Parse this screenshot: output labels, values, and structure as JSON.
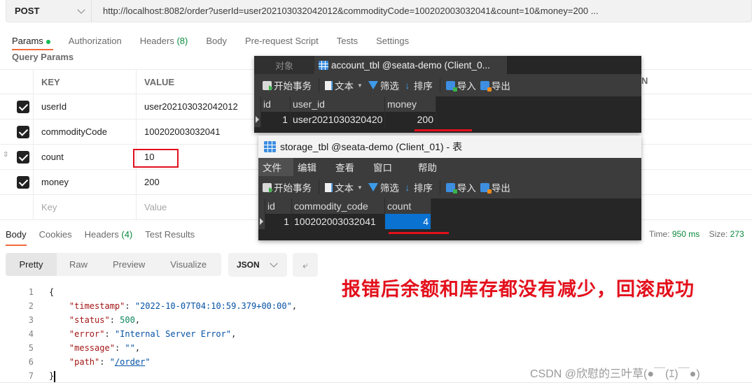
{
  "request": {
    "method": "POST",
    "url": "http://localhost:8082/order?userId=user202103032042012&commodityCode=100202003032041&count=10&money=200 ..."
  },
  "request_tabs": [
    {
      "label": "Params",
      "badge_dot": true,
      "active": true
    },
    {
      "label": "Authorization"
    },
    {
      "label": "Headers",
      "count": "(8)"
    },
    {
      "label": "Body"
    },
    {
      "label": "Pre-request Script"
    },
    {
      "label": "Tests"
    },
    {
      "label": "Settings"
    }
  ],
  "query_params": {
    "title": "Query Params",
    "headers": {
      "key": "KEY",
      "value": "VALUE",
      "description_tail": "N"
    },
    "rows": [
      {
        "key": "userId",
        "value": "user202103032042012",
        "checked": true
      },
      {
        "key": "commodityCode",
        "value": "100202003032041",
        "checked": true
      },
      {
        "key": "count",
        "value": "10",
        "checked": true,
        "highlighted": true
      },
      {
        "key": "money",
        "value": "200",
        "checked": true
      }
    ],
    "new_row": {
      "key_placeholder": "Key",
      "value_placeholder": "Value"
    }
  },
  "response": {
    "tabs": [
      {
        "label": "Body",
        "active": true
      },
      {
        "label": "Cookies"
      },
      {
        "label": "Headers",
        "count": "(4)"
      },
      {
        "label": "Test Results"
      }
    ],
    "time_label": "Time:",
    "time_value": "950 ms",
    "size_label": "Size:",
    "size_value": "273",
    "view_modes": [
      "Pretty",
      "Raw",
      "Preview",
      "Visualize"
    ],
    "active_view": "Pretty",
    "format": "JSON",
    "wrap_icon": "wrap-lines-icon",
    "code_lines": [
      {
        "n": "1",
        "open": "{"
      },
      {
        "n": "2",
        "key": "\"timestamp\"",
        "val": "\"2022-10-07T04:10:59.379+00:00\"",
        "type": "string",
        "comma": ","
      },
      {
        "n": "3",
        "key": "\"status\"",
        "val": "500",
        "type": "number",
        "comma": ","
      },
      {
        "n": "4",
        "key": "\"error\"",
        "val": "\"Internal Server Error\"",
        "type": "string",
        "comma": ","
      },
      {
        "n": "5",
        "key": "\"message\"",
        "val": "\"\"",
        "type": "string",
        "comma": ","
      },
      {
        "n": "6",
        "key": "\"path\"",
        "val_prefix": "\"",
        "val_link": "/order",
        "val_suffix": "\"",
        "type": "link"
      },
      {
        "n": "7",
        "close": "}"
      }
    ]
  },
  "navicat_account": {
    "tab_objects": "对象",
    "tab_title": "account_tbl @seata-demo (Client_0...",
    "toolbar": [
      "开始事务",
      "文本",
      "筛选",
      "排序",
      "导入",
      "导出"
    ],
    "columns": [
      "id",
      "user_id",
      "money"
    ],
    "rows": [
      [
        "1",
        "user2021030320420",
        "200"
      ]
    ]
  },
  "navicat_storage": {
    "title": "storage_tbl @seata-demo (Client_01) - 表",
    "menu": [
      "文件",
      "编辑",
      "查看",
      "窗口",
      "帮助"
    ],
    "toolbar": [
      "开始事务",
      "文本",
      "筛选",
      "排序",
      "导入",
      "导出"
    ],
    "columns": [
      "id",
      "commodity_code",
      "count"
    ],
    "rows": [
      [
        "1",
        "100202003032041",
        "4"
      ]
    ]
  },
  "annotation": "报错后余额和库存都没有减少，回滚成功",
  "watermark": "CSDN @欣慰的三叶草(●￣(ｴ)￣●)",
  "colors": {
    "accent_orange": "#f26b3a",
    "status_green": "#0b8a3c",
    "highlight_red": "#e3101c",
    "selection_blue": "#0a72d1"
  }
}
